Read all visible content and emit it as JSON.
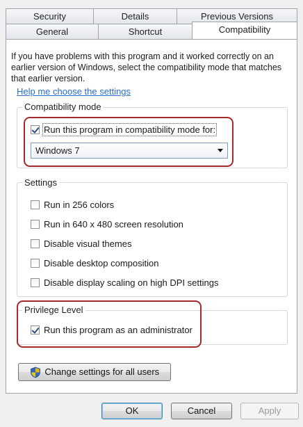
{
  "tabs": {
    "back_row": [
      "Security",
      "Details",
      "Previous Versions"
    ],
    "front_row": [
      "General",
      "Shortcut",
      "Compatibility"
    ],
    "active": "Compatibility"
  },
  "intro_text": "If you have problems with this program and it worked correctly on an earlier version of Windows, select the compatibility mode that matches that earlier version.",
  "help_link": "Help me choose the settings",
  "compat_mode": {
    "title": "Compatibility mode",
    "checkbox_label": "Run this program in compatibility mode for:",
    "checked": true,
    "selected_value": "Windows 7"
  },
  "settings": {
    "title": "Settings",
    "items": [
      {
        "label": "Run in 256 colors",
        "checked": false
      },
      {
        "label": "Run in 640 x 480 screen resolution",
        "checked": false
      },
      {
        "label": "Disable visual themes",
        "checked": false
      },
      {
        "label": "Disable desktop composition",
        "checked": false
      },
      {
        "label": "Disable display scaling on high DPI settings",
        "checked": false
      }
    ]
  },
  "privilege": {
    "title": "Privilege Level",
    "checkbox_label": "Run this program as an administrator",
    "checked": true
  },
  "change_all_users_label": "Change settings for all users",
  "buttons": {
    "ok": "OK",
    "cancel": "Cancel",
    "apply": "Apply"
  },
  "colors": {
    "highlight": "#a32a2a",
    "link": "#2a6cc8"
  },
  "icons": {
    "change_all_users": "uac-shield-icon",
    "check": "checkmark-icon"
  }
}
